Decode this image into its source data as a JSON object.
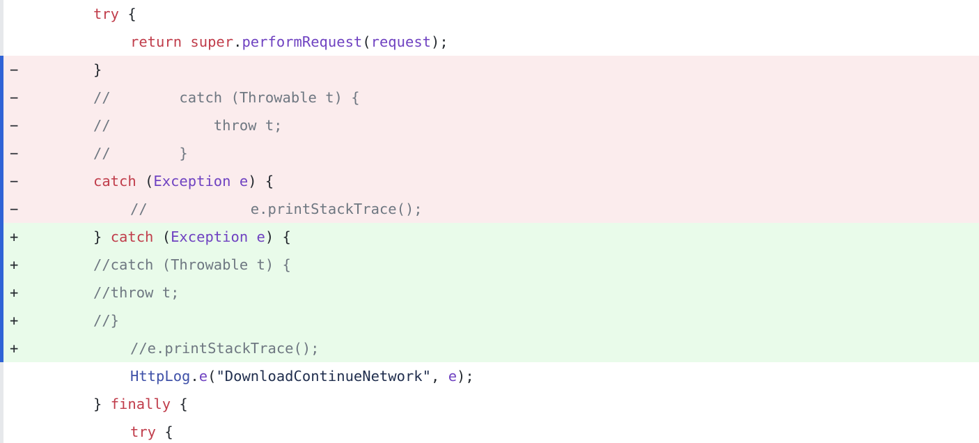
{
  "colors": {
    "deleted_bg": "#fbeced",
    "added_bg": "#e9fbea",
    "change_bar": "#2f63d6",
    "keyword": "#c03d4b",
    "identifier": "#6f42c1",
    "comment": "#6e7781"
  },
  "lines": [
    {
      "marker": "",
      "tokens": [
        "try",
        " {"
      ]
    },
    {
      "marker": "",
      "tokens": [
        "return",
        " ",
        "super",
        ".",
        "performRequest",
        "(",
        "request",
        ");"
      ]
    },
    {
      "marker": "−",
      "tokens": [
        "}"
      ]
    },
    {
      "marker": "−",
      "tokens": [
        "//        catch (Throwable t) {"
      ]
    },
    {
      "marker": "−",
      "tokens": [
        "//            throw t;"
      ]
    },
    {
      "marker": "−",
      "tokens": [
        "//        }"
      ]
    },
    {
      "marker": "−",
      "tokens": [
        "catch",
        " (",
        "Exception",
        " ",
        "e",
        ") {"
      ]
    },
    {
      "marker": "−",
      "tokens": [
        "//            e.printStackTrace();"
      ]
    },
    {
      "marker": "+",
      "tokens": [
        "} ",
        "catch",
        " (",
        "Exception",
        " ",
        "e",
        ") {"
      ]
    },
    {
      "marker": "+",
      "tokens": [
        "//catch (Throwable t) {"
      ]
    },
    {
      "marker": "+",
      "tokens": [
        "//throw t;"
      ]
    },
    {
      "marker": "+",
      "tokens": [
        "//}"
      ]
    },
    {
      "marker": "+",
      "tokens": [
        "//e.printStackTrace();"
      ]
    },
    {
      "marker": "",
      "tokens": [
        "HttpLog",
        ".",
        "e",
        "(",
        "\"DownloadContinueNetwork\"",
        ", ",
        "e",
        ");"
      ]
    },
    {
      "marker": "",
      "tokens": [
        "} ",
        "finally",
        " {"
      ]
    },
    {
      "marker": "",
      "tokens": [
        "try",
        " {"
      ]
    }
  ]
}
